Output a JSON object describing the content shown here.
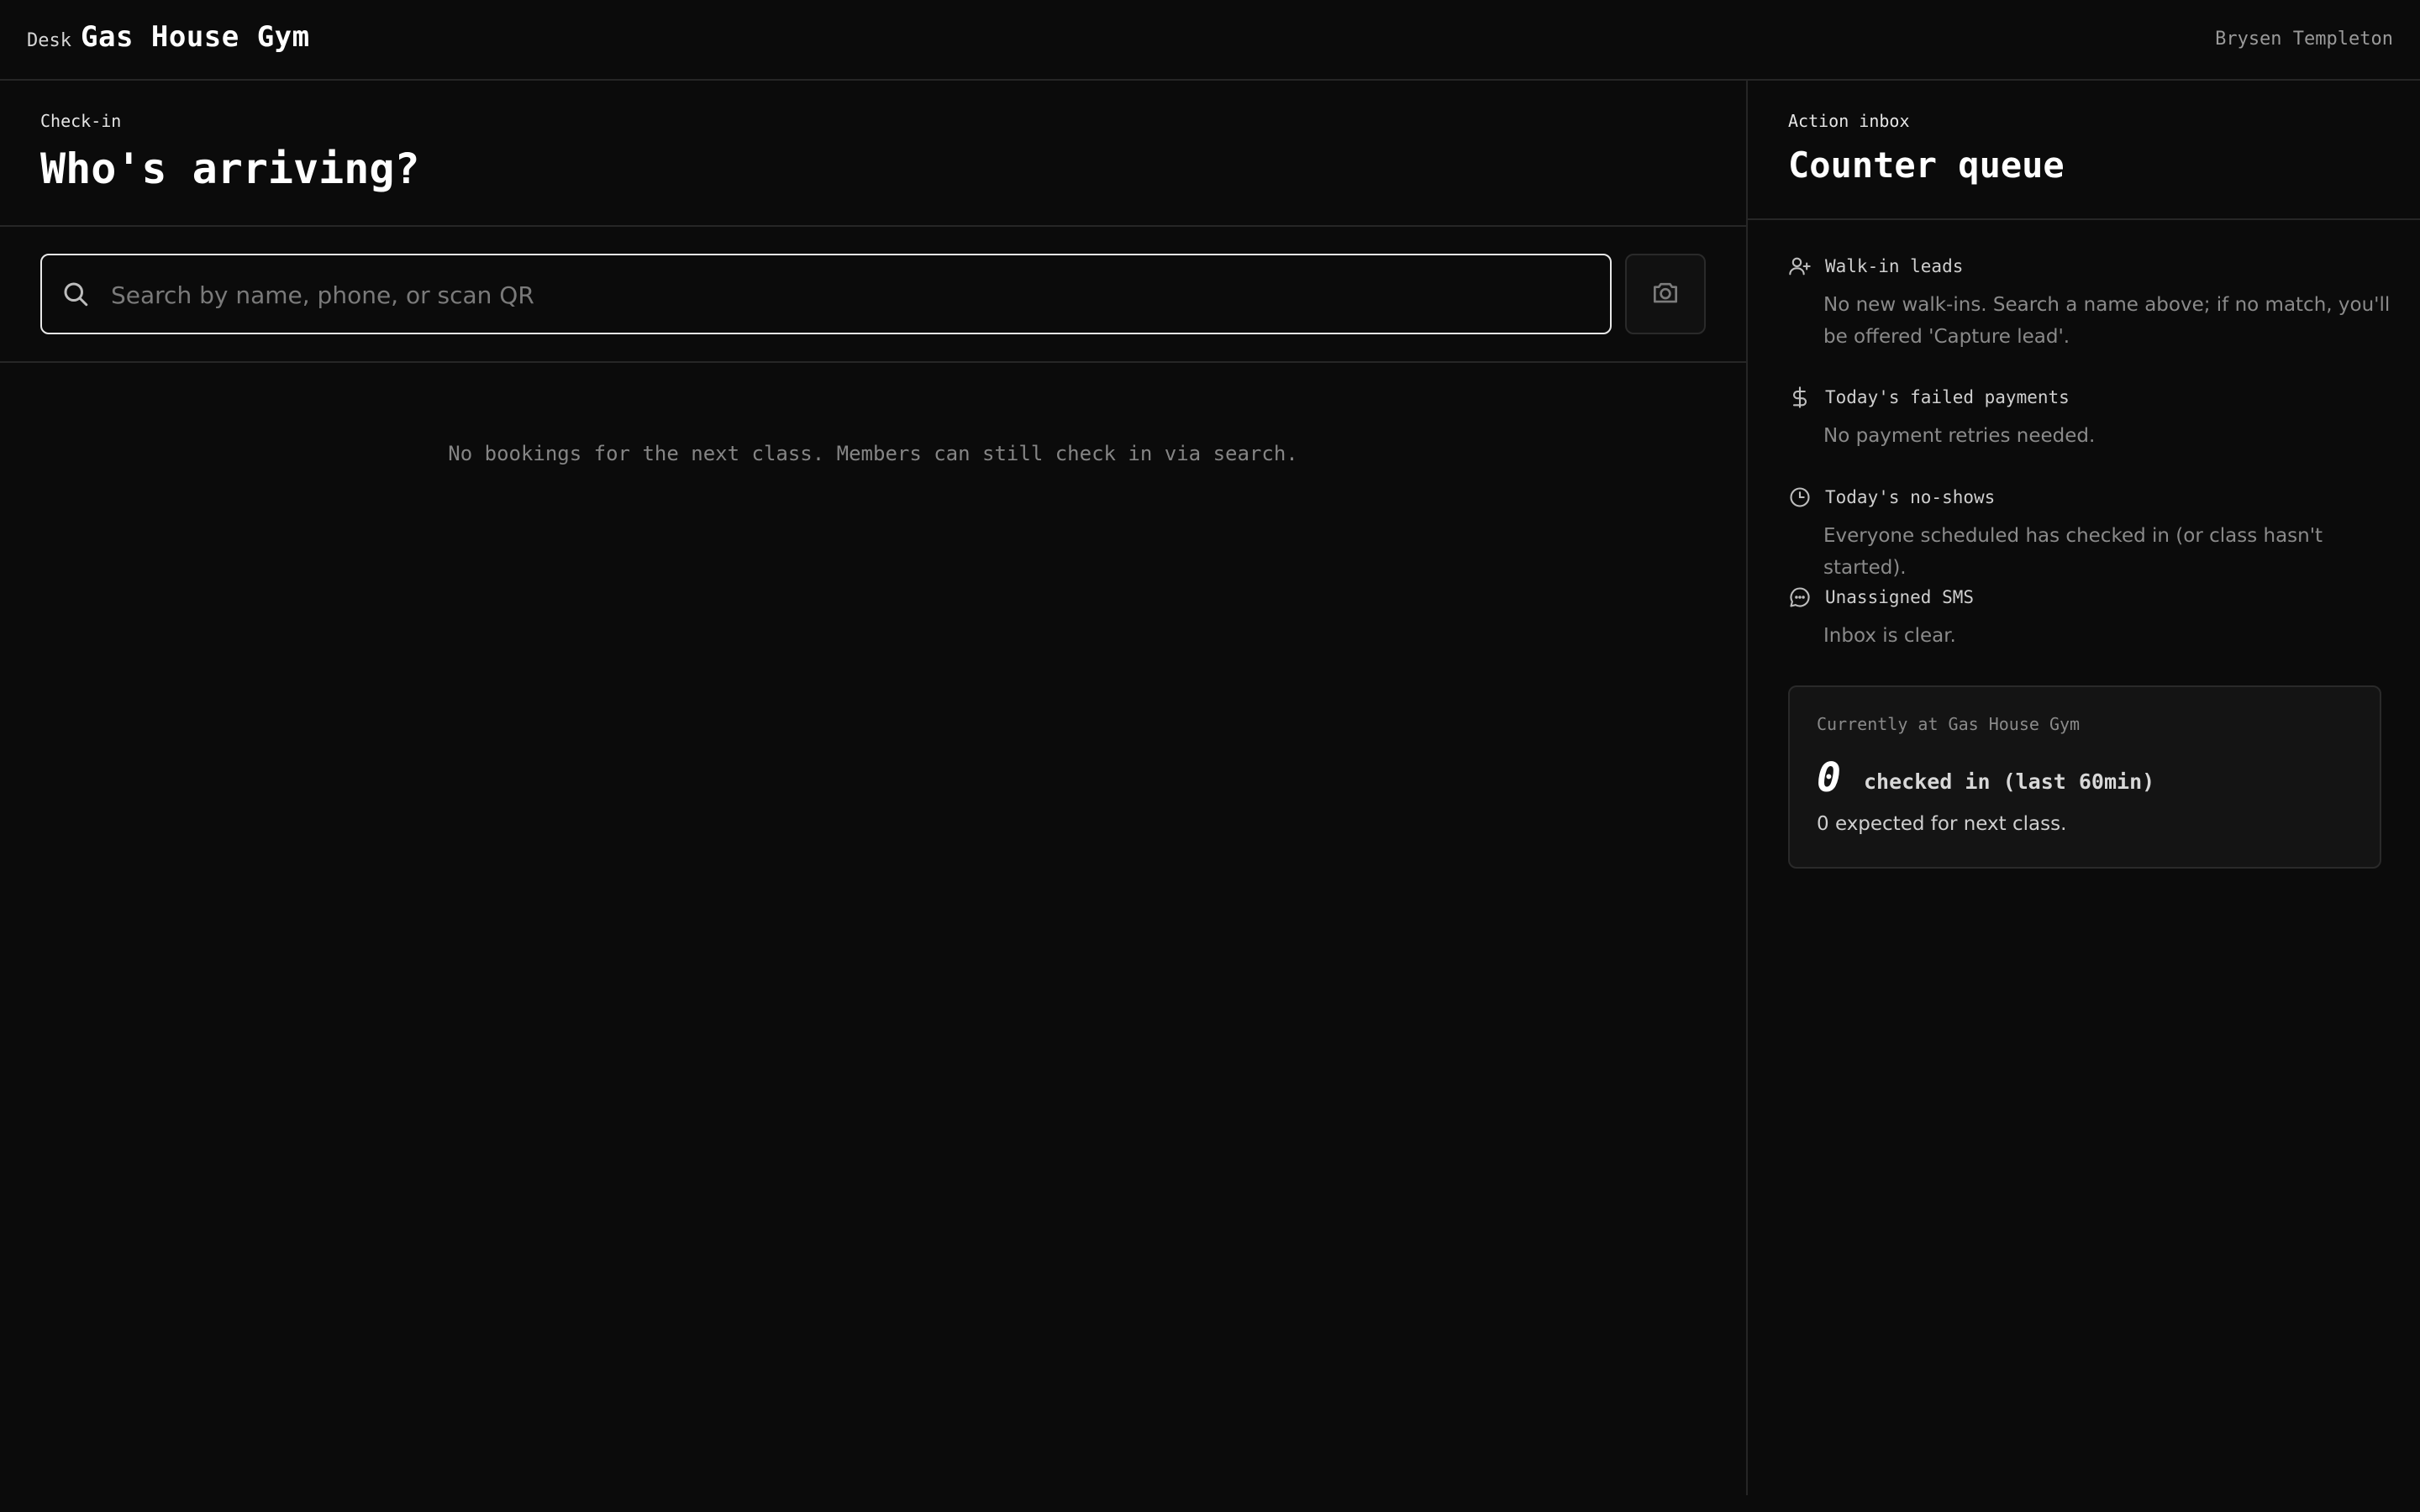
{
  "header": {
    "prefix": "Desk",
    "gym_name": "Gas House Gym",
    "user_name": "Brysen Templeton"
  },
  "checkin": {
    "eyebrow": "Check-in",
    "title": "Who's arriving?",
    "search_placeholder": "Search by name, phone, or scan QR",
    "search_value": "",
    "empty_message": "No bookings for the next class. Members can still check in via search."
  },
  "inbox": {
    "eyebrow": "Action inbox",
    "title": "Counter queue",
    "items": [
      {
        "icon": "user-plus-icon",
        "label": "Walk-in leads",
        "description": "No new walk-ins. Search a name above; if no match, you'll be offered 'Capture lead'."
      },
      {
        "icon": "dollar-icon",
        "label": "Today's failed payments",
        "description": "No payment retries needed."
      },
      {
        "icon": "clock-icon",
        "label": "Today's no-shows",
        "description": "Everyone scheduled has checked in (or class hasn't started)."
      },
      {
        "icon": "message-icon",
        "label": "Unassigned SMS",
        "description": "Inbox is clear."
      }
    ],
    "presence": {
      "label": "Currently at Gas House Gym",
      "count": "0",
      "unit": "checked in (last 60min)",
      "subtext": "0 expected for next class."
    }
  },
  "colors": {
    "background": "#0b0b0b",
    "border": "#262626",
    "text_primary": "#ffffff",
    "text_muted": "#8a8a8a"
  }
}
